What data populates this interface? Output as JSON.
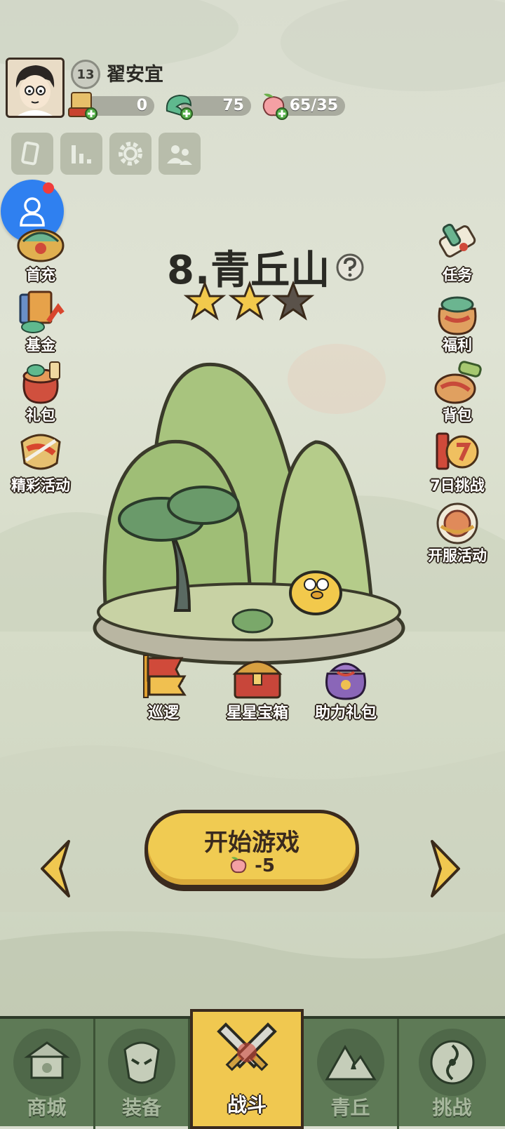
{
  "player": {
    "level": "13",
    "name": "翟安宜"
  },
  "resources": [
    {
      "name": "scroll-ticket",
      "value": "0"
    },
    {
      "name": "jade-dragon",
      "value": "75"
    },
    {
      "name": "peach-stamina",
      "value": "65/35"
    }
  ],
  "toolbar": [
    "cards-icon",
    "ranking-icon",
    "settings-icon",
    "friends-icon"
  ],
  "left_menu": [
    {
      "label": "首充",
      "icon": "first-recharge-icon"
    },
    {
      "label": "基金",
      "icon": "fund-icon"
    },
    {
      "label": "礼包",
      "icon": "gift-bag-icon"
    },
    {
      "label": "精彩活动",
      "icon": "events-icon"
    }
  ],
  "right_menu": [
    {
      "label": "任务",
      "icon": "task-scroll-icon"
    },
    {
      "label": "福利",
      "icon": "welfare-bag-icon"
    },
    {
      "label": "背包",
      "icon": "backpack-icon"
    },
    {
      "label": "7日挑战",
      "icon": "seven-day-challenge-icon"
    },
    {
      "label": "开服活动",
      "icon": "server-launch-icon"
    }
  ],
  "stage": {
    "title": "8.青丘山",
    "stars_earned": 2,
    "stars_total": 3
  },
  "island_buttons": [
    {
      "label": "巡逻",
      "icon": "patrol-flag-icon"
    },
    {
      "label": "星星宝箱",
      "icon": "star-chest-icon"
    },
    {
      "label": "助力礼包",
      "icon": "assist-gift-icon"
    }
  ],
  "start": {
    "label": "开始游戏",
    "cost": "-5"
  },
  "bottom_nav": [
    {
      "label": "商城",
      "icon": "shop-icon",
      "active": false
    },
    {
      "label": "装备",
      "icon": "equipment-icon",
      "active": false
    },
    {
      "label": "战斗",
      "icon": "battle-swords-icon",
      "active": true
    },
    {
      "label": "青丘",
      "icon": "qingqiu-mountain-icon",
      "active": false
    },
    {
      "label": "挑战",
      "icon": "challenge-icon",
      "active": false
    }
  ],
  "colors": {
    "accent": "#f0c850",
    "nav": "#5e7a56",
    "social": "#2f80f0"
  }
}
